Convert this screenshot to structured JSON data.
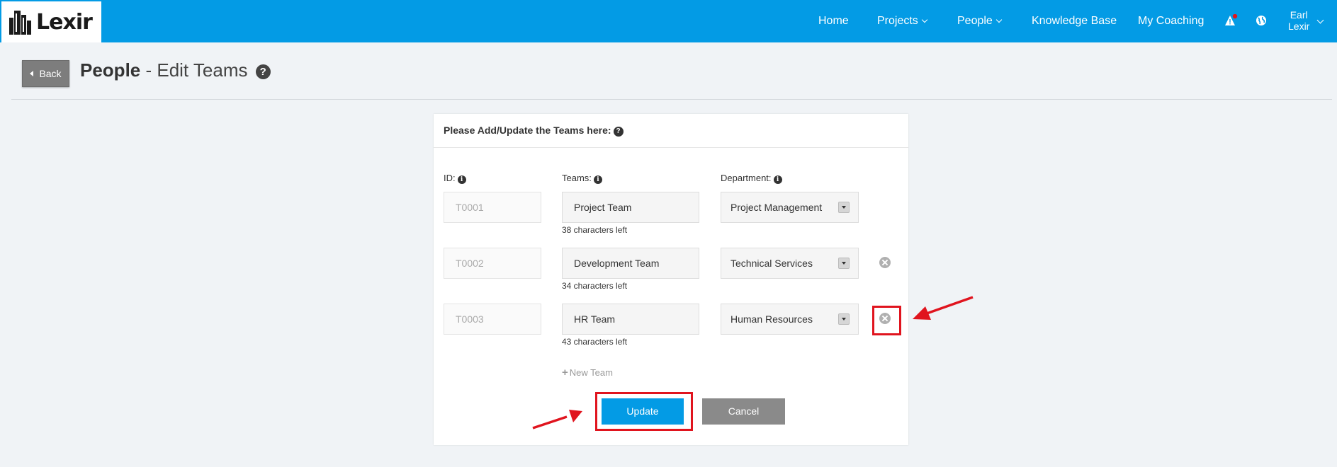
{
  "brand": {
    "logo_text": "Lexir"
  },
  "nav": {
    "home": "Home",
    "projects": "Projects",
    "people": "People",
    "knowledge_base": "Knowledge Base",
    "my_coaching": "My Coaching",
    "user_first": "Earl",
    "user_last": "Lexir"
  },
  "header": {
    "back_label": "Back",
    "title_bold": "People",
    "title_rest": " - Edit Teams",
    "help_glyph": "?"
  },
  "form": {
    "heading": "Please Add/Update the Teams here:",
    "col_id": "ID:",
    "col_teams": "Teams:",
    "col_department": "Department:",
    "rows": [
      {
        "id": "T0001",
        "team": "Project Team",
        "chars_left": "38 characters left",
        "department": "Project Management"
      },
      {
        "id": "T0002",
        "team": "Development Team",
        "chars_left": "34 characters left",
        "department": "Technical Services"
      },
      {
        "id": "T0003",
        "team": "HR Team",
        "chars_left": "43 characters left",
        "department": "Human Resources"
      }
    ],
    "new_team_label": "New Team",
    "update_label": "Update",
    "cancel_label": "Cancel"
  },
  "colors": {
    "topbar": "#039be5",
    "primary_button": "#039be5",
    "cancel_button": "#8a8a8a",
    "annotation": "#e0141e"
  }
}
